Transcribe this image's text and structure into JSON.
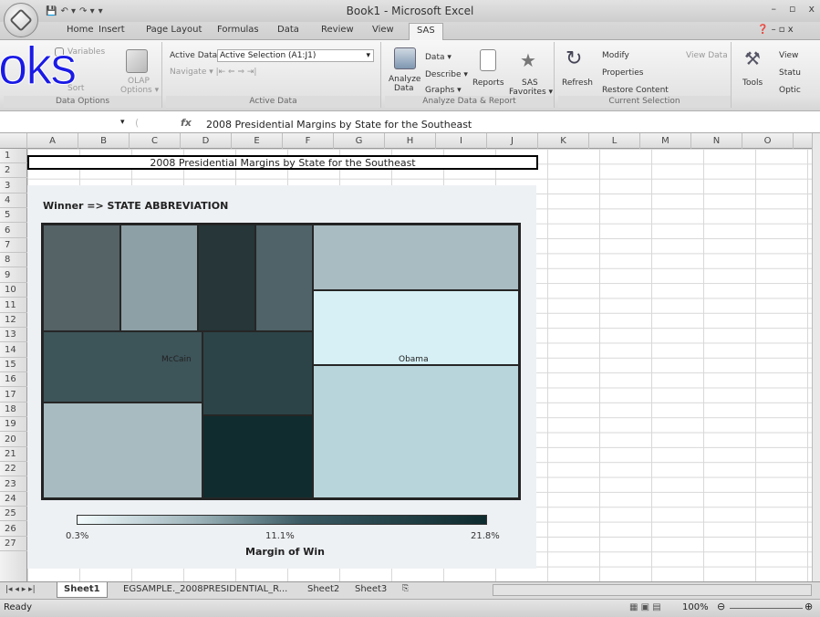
{
  "window": {
    "title": "Book1 - Microsoft Excel",
    "min": "–",
    "max": "▫",
    "close": "x"
  },
  "qat": {
    "save": "💾",
    "undo": "↶ ▾",
    "redo": "↷ ▾",
    "more": "▾"
  },
  "tabs": [
    "Home",
    "Insert",
    "Page Layout",
    "Formulas",
    "Data",
    "Review",
    "View",
    "SAS"
  ],
  "active_tab": "SAS",
  "ribbon": {
    "data_options": {
      "variables": "Variables",
      "sort": "Sort",
      "olap": "OLAP",
      "olap2": "Options ▾",
      "label": "Data Options"
    },
    "active_data": {
      "active_data_label": "Active Data",
      "active_selection": "Active Selection (A1:J1)",
      "navigate": "Navigate ▾ |⇤ ⇐ ⇒ ⇥|",
      "label": "Active Data"
    },
    "analyze": {
      "analyze": "Analyze",
      "analyze2": "Data",
      "data": "Data ▾",
      "describe": "Describe ▾",
      "graphs": "Graphs ▾",
      "reports": "Reports",
      "sas": "SAS",
      "favorites": "Favorites ▾",
      "label": "Analyze Data & Report"
    },
    "current": {
      "refresh": "Refresh",
      "modify": "Modify",
      "properties": "Properties",
      "restore": "Restore Content",
      "view_data": "View Data",
      "label": "Current Selection"
    },
    "tools": {
      "tools": "Tools",
      "view": "View",
      "status": "Statu",
      "options": "Optic"
    }
  },
  "watermark_overlay": "oks",
  "formula_bar": {
    "fx": "fx",
    "formula": "2008 Presidential Margins by State for the Southeast"
  },
  "columns": [
    "A",
    "B",
    "C",
    "D",
    "E",
    "F",
    "G",
    "H",
    "I",
    "J",
    "K",
    "L",
    "M",
    "N",
    "O"
  ],
  "rows": [
    "1",
    "2",
    "3",
    "4",
    "5",
    "6",
    "7",
    "8",
    "9",
    "10",
    "11",
    "12",
    "13",
    "14",
    "15",
    "16",
    "17",
    "18",
    "19",
    "20",
    "21",
    "22",
    "23",
    "24",
    "25",
    "26",
    "27"
  ],
  "cell_a1": "2008 Presidential Margins by State for the Southeast",
  "chart": {
    "title": "Winner => STATE ABBREVIATION",
    "mccain_label": "McCain",
    "obama_label": "Obama",
    "legend_title": "Margin of Win",
    "ticks": [
      "0.3%",
      "11.1%",
      "21.8%"
    ]
  },
  "chart_data": {
    "type": "heatmap",
    "title": "Winner => STATE ABBREVIATION",
    "groups": [
      "McCain",
      "Obama"
    ],
    "color_scale": {
      "min": 0.3,
      "mid": 11.1,
      "max": 21.8,
      "unit": "%",
      "label": "Margin of Win"
    }
  },
  "sheets": [
    "Sheet1",
    "EGSAMPLE._2008PRESIDENTIAL_R...",
    "Sheet2",
    "Sheet3"
  ],
  "active_sheet": "Sheet1",
  "status": {
    "ready": "Ready",
    "zoom": "100%"
  }
}
